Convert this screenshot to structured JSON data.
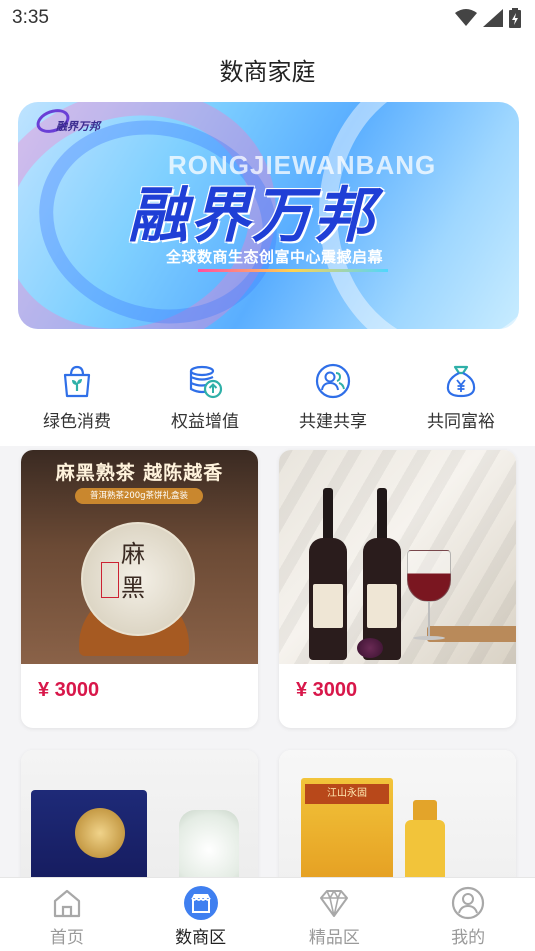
{
  "status_bar": {
    "time": "3:35",
    "icons": [
      "wifi-icon",
      "cellular-signal-icon",
      "battery-charging-icon"
    ]
  },
  "header": {
    "title": "数商家庭"
  },
  "banner": {
    "logo_text": "融界万邦",
    "latin_text": "RONGJIEWANBANG",
    "title": "融界万邦",
    "subtitle": "全球数商生态创富中心震撼启幕"
  },
  "quick_nav": [
    {
      "label": "绿色消费",
      "icon": "shopping-bag-sprout-icon"
    },
    {
      "label": "权益增值",
      "icon": "coin-stack-up-icon"
    },
    {
      "label": "共建共享",
      "icon": "users-circle-icon"
    },
    {
      "label": "共同富裕",
      "icon": "money-bag-icon"
    }
  ],
  "products": [
    {
      "image_title": "麻黑熟茶 越陈越香",
      "image_tag": "普洱熟茶200g茶饼礼盒装",
      "cake_chars": [
        "麻",
        "黑"
      ],
      "price": "¥ 3000"
    },
    {
      "price": "¥ 3000"
    },
    {},
    {
      "box_label": "江山永固"
    }
  ],
  "tab_bar": [
    {
      "label": "首页",
      "icon": "home-icon",
      "active": false
    },
    {
      "label": "数商区",
      "icon": "store-icon",
      "active": true
    },
    {
      "label": "精品区",
      "icon": "diamond-icon",
      "active": false
    },
    {
      "label": "我的",
      "icon": "user-icon",
      "active": false
    }
  ],
  "colors": {
    "price": "#d8174a",
    "accent_blue": "#2f6fe8",
    "tab_inactive": "#9a9a9a"
  }
}
